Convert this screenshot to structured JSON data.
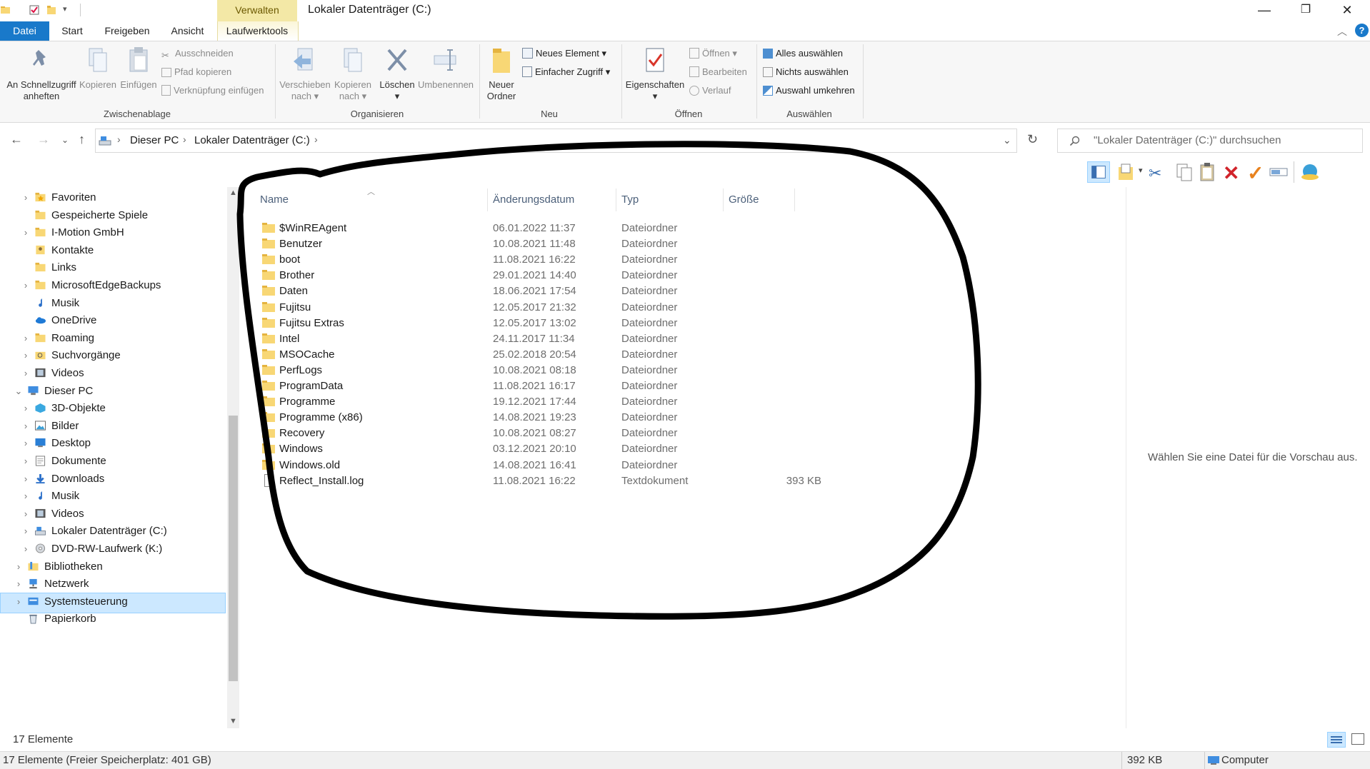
{
  "window": {
    "title": "Lokaler Datenträger (C:)",
    "context_header": "Verwalten",
    "controls": {
      "minimize": "—",
      "restore": "❐",
      "close": "✕"
    }
  },
  "ribbon_tabs": [
    {
      "label": "Datei"
    },
    {
      "label": "Start"
    },
    {
      "label": "Freigeben"
    },
    {
      "label": "Ansicht"
    },
    {
      "label": "Laufwerktools"
    }
  ],
  "ribbon": {
    "zwischenablage": {
      "label": "Zwischenablage",
      "pin": "An Schnellzugriff anheften",
      "pin_line1": "An Schnellzugriff",
      "pin_line2": "anheften",
      "copy": "Kopieren",
      "paste": "Einfügen",
      "cut": "Ausschneiden",
      "copy_path": "Pfad kopieren",
      "paste_shortcut": "Verknüpfung einfügen"
    },
    "organisieren": {
      "label": "Organisieren",
      "move_line1": "Verschieben",
      "move_line2": "nach",
      "copyto_line1": "Kopieren",
      "copyto_line2": "nach",
      "delete": "Löschen",
      "rename": "Umbenennen"
    },
    "neu": {
      "label": "Neu",
      "new_folder_line1": "Neuer",
      "new_folder_line2": "Ordner",
      "new_item": "Neues Element",
      "easy_access": "Einfacher Zugriff"
    },
    "oeffnen": {
      "label": "Öffnen",
      "properties": "Eigenschaften",
      "open": "Öffnen",
      "edit": "Bearbeiten",
      "history": "Verlauf"
    },
    "auswaehlen": {
      "label": "Auswählen",
      "select_all": "Alles auswählen",
      "select_none": "Nichts auswählen",
      "invert": "Auswahl umkehren"
    }
  },
  "address": {
    "crumbs": [
      "Dieser PC",
      "Lokaler Datenträger (C:)"
    ],
    "search_placeholder": "\"Lokaler Datenträger (C:)\" durchsuchen"
  },
  "nav": [
    {
      "label": "Favoriten",
      "icon": "star-folder",
      "expandable": true
    },
    {
      "label": "Gespeicherte Spiele",
      "icon": "folder",
      "expandable": false
    },
    {
      "label": "I-Motion GmbH",
      "icon": "folder",
      "expandable": true
    },
    {
      "label": "Kontakte",
      "icon": "contacts",
      "expandable": false
    },
    {
      "label": "Links",
      "icon": "folder",
      "expandable": false
    },
    {
      "label": "MicrosoftEdgeBackups",
      "icon": "folder",
      "expandable": true
    },
    {
      "label": "Musik",
      "icon": "music",
      "expandable": false
    },
    {
      "label": "OneDrive",
      "icon": "cloud",
      "expandable": false
    },
    {
      "label": "Roaming",
      "icon": "folder",
      "expandable": true
    },
    {
      "label": "Suchvorgänge",
      "icon": "search-folder",
      "expandable": true
    },
    {
      "label": "Videos",
      "icon": "video",
      "expandable": true
    },
    {
      "label": "Dieser PC",
      "icon": "pc",
      "expandable": true,
      "expanded": true
    },
    {
      "label": "3D-Objekte",
      "icon": "cube",
      "expandable": true
    },
    {
      "label": "Bilder",
      "icon": "pictures",
      "expandable": true
    },
    {
      "label": "Desktop",
      "icon": "desktop",
      "expandable": true
    },
    {
      "label": "Dokumente",
      "icon": "documents",
      "expandable": true
    },
    {
      "label": "Downloads",
      "icon": "downloads",
      "expandable": true
    },
    {
      "label": "Musik",
      "icon": "music",
      "expandable": true
    },
    {
      "label": "Videos",
      "icon": "video",
      "expandable": true
    },
    {
      "label": "Lokaler Datenträger (C:)",
      "icon": "drive",
      "expandable": true,
      "selected": true
    },
    {
      "label": "DVD-RW-Laufwerk (K:)",
      "icon": "dvd",
      "expandable": true
    },
    {
      "label": "Bibliotheken",
      "icon": "library",
      "expandable": true
    },
    {
      "label": "Netzwerk",
      "icon": "network",
      "expandable": true
    },
    {
      "label": "Systemsteuerung",
      "icon": "control-panel",
      "expandable": true
    },
    {
      "label": "Papierkorb",
      "icon": "recycle-bin",
      "expandable": false
    }
  ],
  "columns": {
    "name": "Name",
    "date": "Änderungsdatum",
    "type": "Typ",
    "size": "Größe"
  },
  "files": [
    {
      "name": "$WinREAgent",
      "date": "06.01.2022 11:37",
      "type": "Dateiordner",
      "size": "",
      "kind": "folder"
    },
    {
      "name": "Benutzer",
      "date": "10.08.2021 11:48",
      "type": "Dateiordner",
      "size": "",
      "kind": "folder"
    },
    {
      "name": "boot",
      "date": "11.08.2021 16:22",
      "type": "Dateiordner",
      "size": "",
      "kind": "folder"
    },
    {
      "name": "Brother",
      "date": "29.01.2021 14:40",
      "type": "Dateiordner",
      "size": "",
      "kind": "folder"
    },
    {
      "name": "Daten",
      "date": "18.06.2021 17:54",
      "type": "Dateiordner",
      "size": "",
      "kind": "folder"
    },
    {
      "name": "Fujitsu",
      "date": "12.05.2017 21:32",
      "type": "Dateiordner",
      "size": "",
      "kind": "folder"
    },
    {
      "name": "Fujitsu Extras",
      "date": "12.05.2017 13:02",
      "type": "Dateiordner",
      "size": "",
      "kind": "folder"
    },
    {
      "name": "Intel",
      "date": "24.11.2017 11:34",
      "type": "Dateiordner",
      "size": "",
      "kind": "folder"
    },
    {
      "name": "MSOCache",
      "date": "25.02.2018 20:54",
      "type": "Dateiordner",
      "size": "",
      "kind": "folder"
    },
    {
      "name": "PerfLogs",
      "date": "10.08.2021 08:18",
      "type": "Dateiordner",
      "size": "",
      "kind": "folder"
    },
    {
      "name": "ProgramData",
      "date": "11.08.2021 16:17",
      "type": "Dateiordner",
      "size": "",
      "kind": "folder"
    },
    {
      "name": "Programme",
      "date": "19.12.2021 17:44",
      "type": "Dateiordner",
      "size": "",
      "kind": "folder"
    },
    {
      "name": "Programme (x86)",
      "date": "14.08.2021 19:23",
      "type": "Dateiordner",
      "size": "",
      "kind": "folder"
    },
    {
      "name": "Recovery",
      "date": "10.08.2021 08:27",
      "type": "Dateiordner",
      "size": "",
      "kind": "folder"
    },
    {
      "name": "Windows",
      "date": "03.12.2021 20:10",
      "type": "Dateiordner",
      "size": "",
      "kind": "folder"
    },
    {
      "name": "Windows.old",
      "date": "14.08.2021 16:41",
      "type": "Dateiordner",
      "size": "",
      "kind": "folder"
    },
    {
      "name": "Reflect_Install.log",
      "date": "11.08.2021 16:22",
      "type": "Textdokument",
      "size": "393 KB",
      "kind": "file"
    }
  ],
  "preview": {
    "text": "Wählen Sie eine Datei für die Vorschau aus."
  },
  "status": {
    "count": "17 Elemente",
    "free_space": "17 Elemente (Freier Speicherplatz: 401 GB)",
    "size": "392 KB",
    "location": "Computer"
  },
  "colors": {
    "accent": "#1979ca",
    "folder": "#f8d775",
    "folder_dark": "#e5b440",
    "selection": "#cce8ff",
    "context_tab": "#f3e8a6",
    "annotation": "#000000"
  }
}
